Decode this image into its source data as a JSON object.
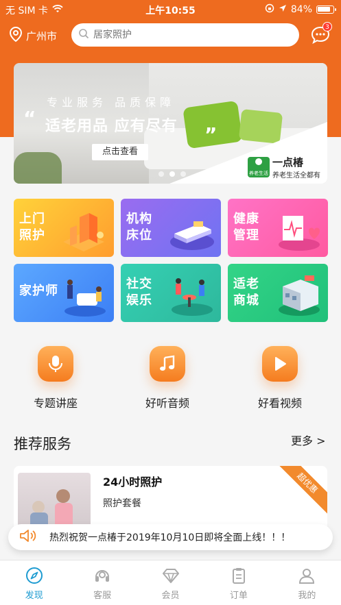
{
  "status_bar": {
    "carrier": "无 SIM 卡",
    "time": "上午10:55",
    "battery": "84%"
  },
  "header": {
    "city": "广州市",
    "search_placeholder": "居家照护",
    "message_badge": "3"
  },
  "banner": {
    "subtitle": "专业服务 品质保障",
    "headline": "适老用品 应有尽有",
    "cta": "点击查看",
    "brand_name": "一点椿",
    "brand_logo_caption": "养老生活",
    "brand_slogan": "养老生活全都有",
    "active_dot_index": 1,
    "dot_count": 3
  },
  "services": [
    {
      "label": "上门照护",
      "colors": [
        "#ffd23a",
        "#ff9d2e"
      ]
    },
    {
      "label": "机构床位",
      "colors": [
        "#9a6cf0",
        "#6f73f2"
      ]
    },
    {
      "label": "健康管理",
      "colors": [
        "#ff73c6",
        "#ff5aa0"
      ]
    },
    {
      "label": "家护师",
      "colors": [
        "#5ca8ff",
        "#3c7ff5"
      ]
    },
    {
      "label": "社交娱乐",
      "colors": [
        "#35d0b3",
        "#2eb89c"
      ]
    },
    {
      "label": "适老商城",
      "colors": [
        "#33d487",
        "#20c07a"
      ]
    }
  ],
  "quick_entries": [
    {
      "label": "专题讲座",
      "icon": "microphone-icon"
    },
    {
      "label": "好听音频",
      "icon": "music-note-icon"
    },
    {
      "label": "好看视频",
      "icon": "play-icon"
    }
  ],
  "recommend": {
    "title": "推荐服务",
    "more": "更多 >",
    "item": {
      "name": "24小时照护",
      "desc": "照护套餐",
      "ribbon": "超优惠"
    }
  },
  "notice": {
    "text": "热烈祝贺一点椿于2019年10月10日即将全面上线！！！",
    "icon": "speaker-icon"
  },
  "tabs": [
    {
      "label": "发现",
      "icon": "compass-icon",
      "active": true
    },
    {
      "label": "客服",
      "icon": "headset-icon",
      "active": false
    },
    {
      "label": "会员",
      "icon": "diamond-icon",
      "active": false
    },
    {
      "label": "订单",
      "icon": "clipboard-icon",
      "active": false
    },
    {
      "label": "我的",
      "icon": "user-icon",
      "active": false
    }
  ],
  "colors": {
    "brand_orange": "#ee6b1f",
    "active_tab": "#1d9bd1"
  }
}
